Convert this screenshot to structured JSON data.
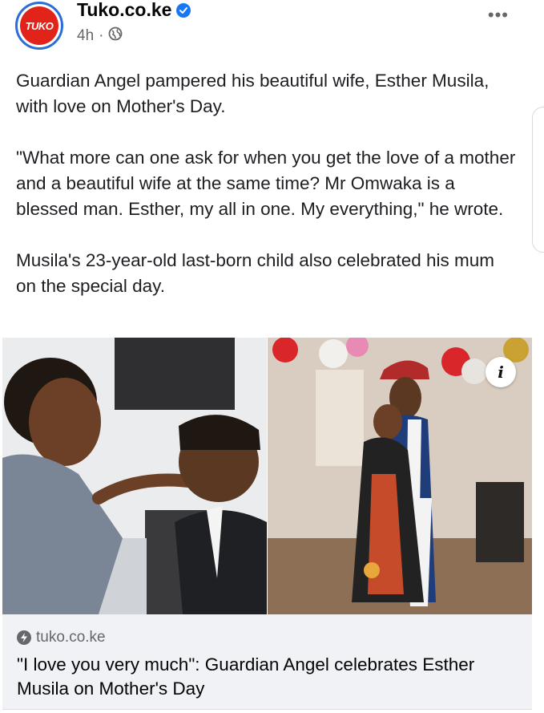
{
  "post": {
    "author": "Tuko.co.ke",
    "avatar_text": "TUKO",
    "time": "4h",
    "separator": "·",
    "more_label": "•••",
    "paragraphs": [
      "Guardian Angel pampered his beautiful wife, Esther Musila, with love on Mother's Day.",
      "\"What more can one ask for when you get the love of a mother and a beautiful wife at the same time? Mr Omwaka is a blessed man. Esther, my all in one. My everything,\" he wrote.",
      "Musila's 23-year-old last-born child also celebrated his mum on the special day."
    ]
  },
  "media": {
    "info_label": "i"
  },
  "link": {
    "domain": "tuko.co.ke",
    "title": "\"I love you very much\": Guardian Angel celebrates Esther Musila on Mother's Day"
  },
  "colors": {
    "brand_red": "#e2231a",
    "verified_blue": "#1877f2",
    "muted": "#65676b",
    "card_bg": "#f0f2f5"
  }
}
